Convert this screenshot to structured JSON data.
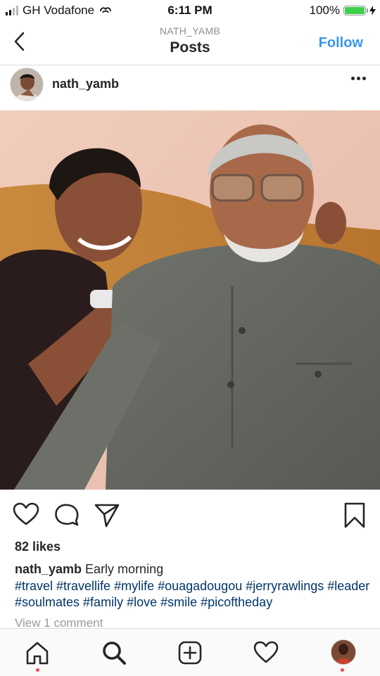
{
  "status_bar": {
    "carrier": "GH Vodafone",
    "time": "6:11 PM",
    "battery_percent": "100%",
    "battery_level": 1.0,
    "signal_bars_filled": 2,
    "signal_bars_total": 4
  },
  "header": {
    "username": "NATH_YAMB",
    "title": "Posts",
    "follow_label": "Follow"
  },
  "post": {
    "username": "nath_yamb",
    "likes": "82 likes",
    "caption_user": "nath_yamb",
    "caption_text": "Early morning",
    "hashtags": "#travel #travellife #mylife #ouagadougou #jerryrawlings #leader #soulmates #family #love #smile #picoftheday",
    "comments_link": "View 1 comment"
  },
  "icons": {
    "back": "chevron-left-icon",
    "more": "more-horizontal-icon",
    "like": "heart-icon",
    "comment": "comment-icon",
    "share": "send-icon",
    "save": "bookmark-icon",
    "home": "home-icon",
    "search": "search-icon",
    "create": "add-post-icon",
    "activity": "heart-icon",
    "profile": "profile-avatar"
  },
  "colors": {
    "link_blue": "#3897f0",
    "hashtag_blue": "#003569",
    "notification_red": "#ed4956",
    "battery_green": "#3fcf4b"
  }
}
